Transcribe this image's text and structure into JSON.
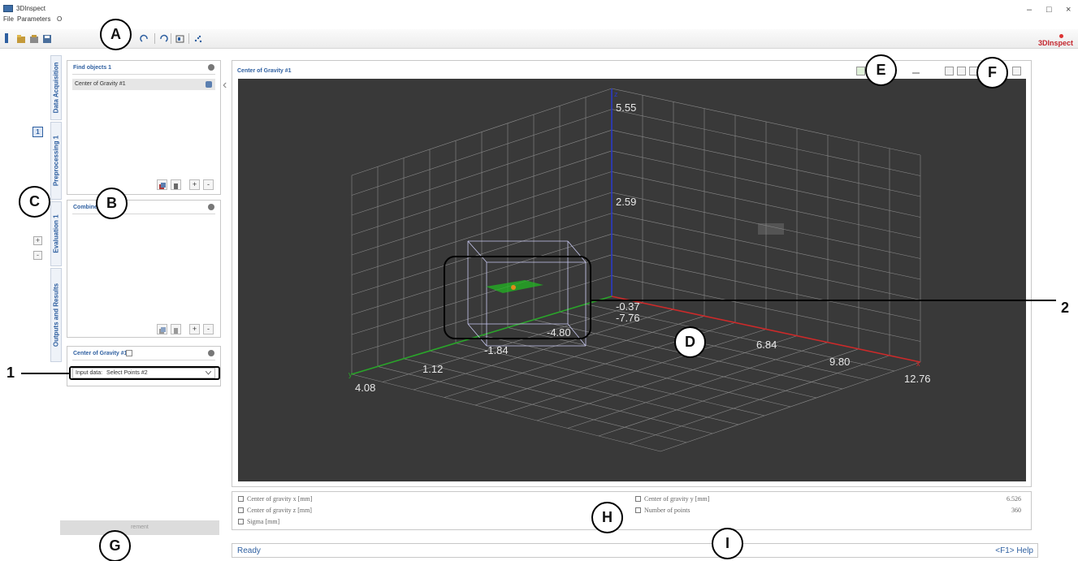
{
  "window": {
    "title": "3DInspect",
    "controls": [
      "–",
      "□",
      "×"
    ]
  },
  "menu": [
    "File",
    "Parameters",
    "O"
  ],
  "brand": "3DInspect",
  "vertical_tabs": [
    "Data Acquisition",
    "Preprocessing 1",
    "Evaluation 1",
    "Outputs and Results"
  ],
  "preprocessing_index": "1",
  "stepper": {
    "plus": "+",
    "minus": "-"
  },
  "find_panel": {
    "title": "Find objects 1",
    "items": [
      "Center of Gravity #1"
    ],
    "add": "+",
    "remove": "-"
  },
  "combine_panel": {
    "title": "Combine",
    "add": "+",
    "remove": "-"
  },
  "cog_panel": {
    "title": "Center of Gravity #1",
    "input_label": "Input data:",
    "input_value": "Select Points #2"
  },
  "start_button": "rement",
  "view": {
    "title": "Center of Gravity #1",
    "z_ticks": [
      "5.55",
      "2.59",
      "-0.37"
    ],
    "x_ticks": [
      "-7.76",
      "6.84",
      "9.80",
      "12.76"
    ],
    "y_ticks": [
      "-4.80",
      "-1.84",
      "1.12",
      "4.08"
    ],
    "axis_letters": {
      "x": "x",
      "y": "y",
      "z": "z"
    }
  },
  "results": [
    {
      "label": "Center of gravity x [mm]",
      "value": ""
    },
    {
      "label": "Center of gravity y [mm]",
      "value": "6.526"
    },
    {
      "label": "Center of gravity z [mm]",
      "value": ""
    },
    {
      "label": "Number of points",
      "value": "360"
    },
    {
      "label": "Sigma [mm]",
      "value": ""
    }
  ],
  "status": {
    "text": "Ready",
    "help": "<F1> Help"
  },
  "callouts": {
    "A": "A",
    "B": "B",
    "C": "C",
    "D": "D",
    "E": "E",
    "F": "F",
    "G": "G",
    "H": "H",
    "I": "I",
    "one": "1",
    "two": "2"
  },
  "colors": {
    "accent": "#2e5fa0",
    "plot_bg": "#393939",
    "grid": "#8a8a8a",
    "x_axis": "#cc2a2a",
    "y_axis": "#2aa52a",
    "z_axis": "#2a3ac8",
    "points": "#22b522",
    "centroid": "#e08a1a"
  }
}
